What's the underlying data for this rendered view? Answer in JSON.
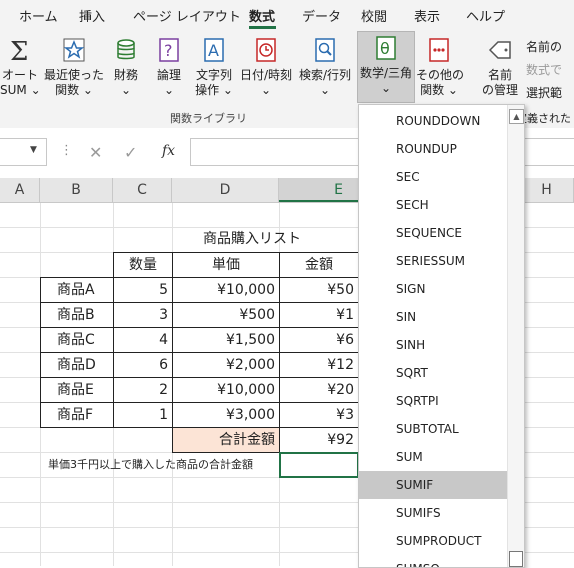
{
  "ribbon_tabs": [
    "ホーム",
    "挿入",
    "ページ レイアウト",
    "数式",
    "データ",
    "校閲",
    "表示",
    "ヘルプ"
  ],
  "ribbon": {
    "buttons": [
      {
        "line1": "オート",
        "line2": "SUM ⌄",
        "icon": "autosum-icon"
      },
      {
        "line1": "最近使った",
        "line2": "関数 ⌄",
        "icon": "star-icon"
      },
      {
        "line1": "財務",
        "line2": "⌄",
        "icon": "coins-icon"
      },
      {
        "line1": "論理",
        "line2": "⌄",
        "icon": "question-book-icon"
      },
      {
        "line1": "文字列",
        "line2": "操作 ⌄",
        "icon": "text-a-icon"
      },
      {
        "line1": "日付/時刻",
        "line2": "⌄",
        "icon": "clock-icon"
      },
      {
        "line1": "検索/行列",
        "line2": "⌄",
        "icon": "magnifier-icon"
      },
      {
        "line1": "数学/三角",
        "line2": "⌄",
        "icon": "theta-icon"
      },
      {
        "line1": "その他の",
        "line2": "関数 ⌄",
        "icon": "more-functions-icon"
      }
    ],
    "name_manager": {
      "line1": "名前",
      "line2": "の管理"
    },
    "side_items": [
      "名前の",
      "数式で",
      "選択範",
      "定義された"
    ],
    "group_label": "関数ライブラリ"
  },
  "formula_bar": {
    "fx": "fx",
    "cancel": "✕",
    "enter": "✓",
    "separator": "⋮"
  },
  "columns": [
    "A",
    "B",
    "C",
    "D",
    "E",
    "H"
  ],
  "sheet": {
    "title": "商品購入リスト",
    "headers": [
      "数量",
      "単価",
      "金額"
    ],
    "rows": [
      {
        "name": "商品A",
        "qty": "5",
        "price": "¥10,000",
        "amount": "¥50"
      },
      {
        "name": "商品B",
        "qty": "3",
        "price": "¥500",
        "amount": "¥1"
      },
      {
        "name": "商品C",
        "qty": "4",
        "price": "¥1,500",
        "amount": "¥6"
      },
      {
        "name": "商品D",
        "qty": "6",
        "price": "¥2,000",
        "amount": "¥12"
      },
      {
        "name": "商品E",
        "qty": "2",
        "price": "¥10,000",
        "amount": "¥20"
      },
      {
        "name": "商品F",
        "qty": "1",
        "price": "¥3,000",
        "amount": "¥3"
      }
    ],
    "total_label": "合計金額",
    "total_value": "¥92",
    "note": "単価3千円以上で購入した商品の合計金額"
  },
  "dropdown": {
    "items": [
      "ROUNDDOWN",
      "ROUNDUP",
      "SEC",
      "SECH",
      "SEQUENCE",
      "SERIESSUM",
      "SIGN",
      "SIN",
      "SINH",
      "SQRT",
      "SQRTPI",
      "SUBTOTAL",
      "SUM",
      "SUMIF",
      "SUMIFS",
      "SUMPRODUCT",
      "SUMSQ"
    ],
    "highlighted": "SUMIF",
    "scroll_up": "▲"
  },
  "colors": {
    "accent": "#217346",
    "highlight": "#c8c8c8",
    "total_fill": "#fce4d6"
  }
}
